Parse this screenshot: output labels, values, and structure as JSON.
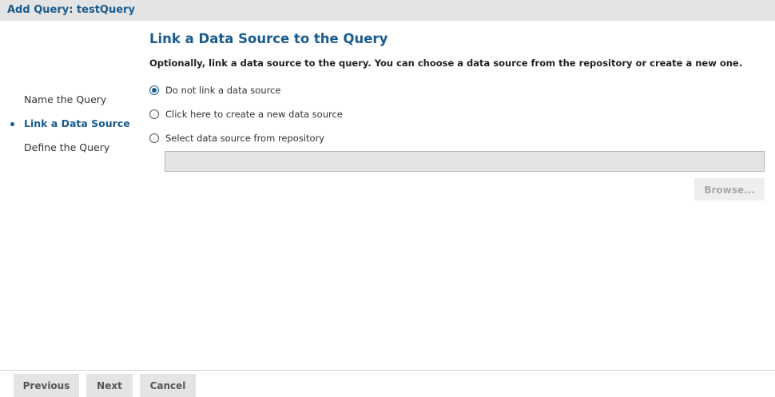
{
  "window": {
    "title": "Add Query: testQuery"
  },
  "steps": {
    "items": [
      {
        "label": "Name the Query",
        "active": false
      },
      {
        "label": "Link a Data Source",
        "active": true
      },
      {
        "label": "Define the Query",
        "active": false
      }
    ]
  },
  "main": {
    "heading": "Link a Data Source to the Query",
    "description": "Optionally, link a data source to the query. You can choose a data source from the repository or create a new one.",
    "options": [
      {
        "label": "Do not link a data source",
        "checked": true
      },
      {
        "label": "Click here to create a new data source",
        "checked": false
      },
      {
        "label": "Select data source from repository",
        "checked": false
      }
    ],
    "repository_path": "",
    "browse_label": "Browse..."
  },
  "footer": {
    "previous_label": "Previous",
    "next_label": "Next",
    "cancel_label": "Cancel"
  },
  "colors": {
    "accent": "#1a5b8e",
    "titlebar_bg": "#e4e4e4",
    "button_bg": "#e4e4e4",
    "disabled_text": "#a8a8a8"
  }
}
